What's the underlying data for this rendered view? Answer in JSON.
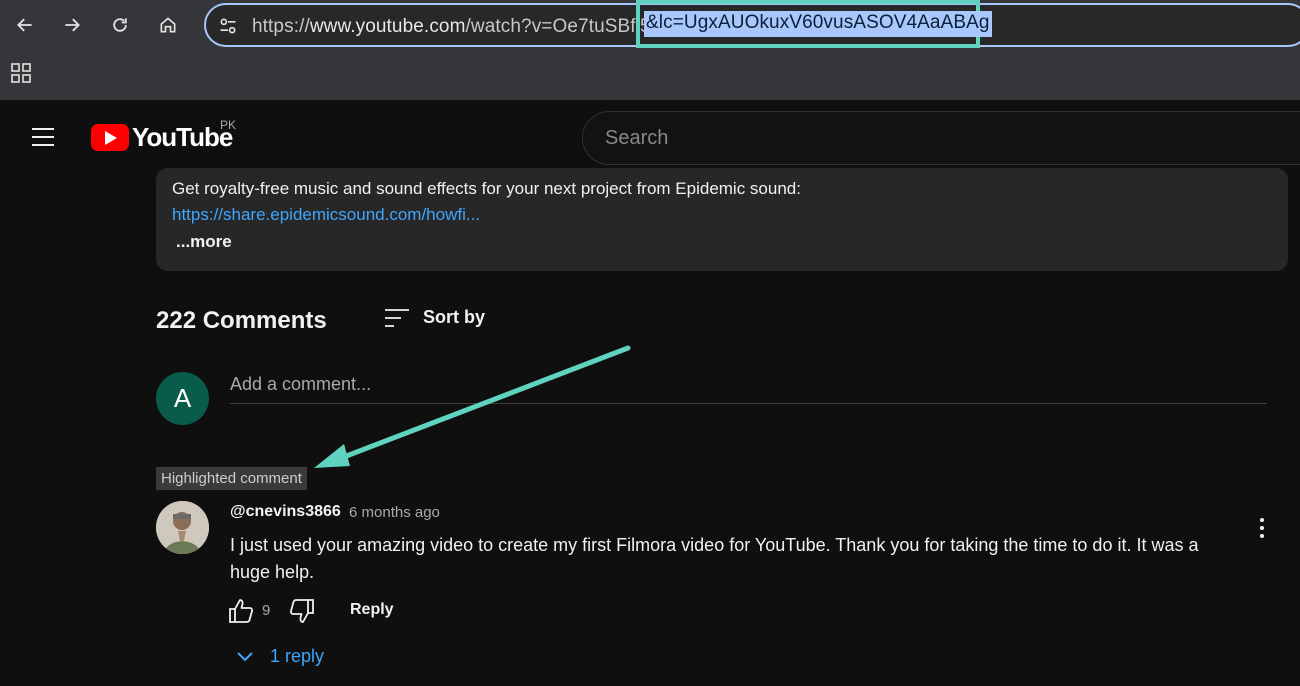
{
  "browser": {
    "url_base": "https://www.youtube.com/watch?v=Oe7tuSBfi5I",
    "url_base_prefix": "https://",
    "url_base_host": "www.youtube.com",
    "url_base_rest": "/watch?v=Oe7tuSBfi5",
    "url_selected": "&lc=UgxAUOkuxV60vusASOV4AaABAg",
    "highlight_color": "#5fd3bf",
    "icons": [
      "back-icon",
      "forward-icon",
      "reload-icon",
      "home-icon",
      "site-info-icon",
      "apps-icon"
    ]
  },
  "youtube": {
    "logo_text": "YouTube",
    "country_code": "PK",
    "search_placeholder": "Search"
  },
  "description": {
    "line1": "Get royalty-free music and sound effects for your next project from Epidemic sound:",
    "link": "https://share.epidemicsound.com/howfi...",
    "more": "...more"
  },
  "comments": {
    "count_label": "222 Comments",
    "sort_label": "Sort by",
    "user_initial": "A",
    "add_placeholder": "Add a comment...",
    "highlighted_label": "Highlighted comment",
    "item": {
      "author": "@cnevins3866",
      "time": "6 months ago",
      "text": "I just used your amazing video to create my first Filmora video for YouTube. Thank you for taking the time to do it. It was a huge help.",
      "likes": "9",
      "reply_label": "Reply",
      "replies_label": "1 reply"
    }
  },
  "colors": {
    "accent_link": "#3ea6ff",
    "annotation": "#5fd3bf",
    "yt_red": "#ff0000"
  }
}
